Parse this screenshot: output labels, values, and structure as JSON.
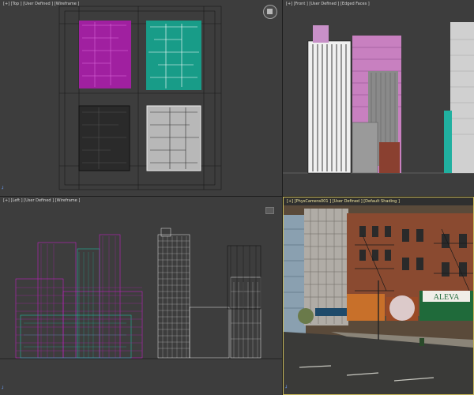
{
  "viewports": {
    "top": {
      "label": "[+] [Top ] [User Defined ] [Wireframe ]"
    },
    "front": {
      "label": "[+] [Front ] [User Defined ] [Edged Faces ]"
    },
    "left": {
      "label": "[+] [Left ] [User Defined ] [Wireframe ]"
    },
    "camera": {
      "label": "[+] [PhysCamera001 ] [User Defined ] [Default Shading ]"
    }
  },
  "signs": {
    "aleva": "ALEVA"
  },
  "colors": {
    "viewport_bg": "#3d3d3d",
    "magenta": "#c020c0",
    "teal": "#20b8a0",
    "wire_white": "#e8e8e8",
    "wire_black": "#151515",
    "active_border": "#c8b85a"
  }
}
